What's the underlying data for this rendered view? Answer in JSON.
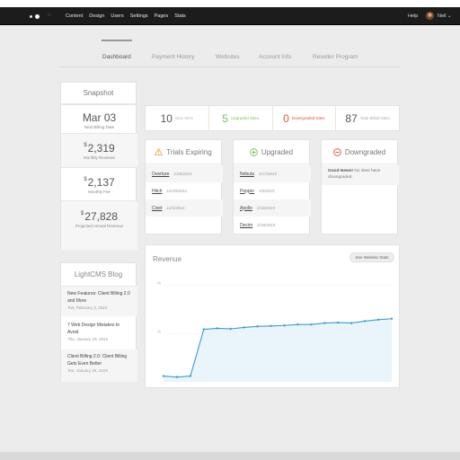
{
  "topbar": {
    "logo_mark": "™",
    "nav": [
      "Content",
      "Design",
      "Users",
      "Settings",
      "Pages",
      "Stats"
    ],
    "help": "Help",
    "user_name": "Neil ⌄"
  },
  "tabs": [
    "Dashboard",
    "Payment History",
    "Websites",
    "Account Info",
    "Reseller Program"
  ],
  "snapshot": {
    "title": "Snapshot",
    "items": [
      {
        "value": "Mar 03",
        "prefix": "",
        "label": "Next Billing Date"
      },
      {
        "value": "2,319",
        "prefix": "$",
        "label": "Monthly Revenue"
      },
      {
        "value": "2,137",
        "prefix": "$",
        "label": "Monthly Fee"
      },
      {
        "value": "27,828",
        "prefix": "$",
        "label": "Projected Annual Revenue"
      }
    ]
  },
  "blog": {
    "title": "LightCMS Blog",
    "posts": [
      {
        "title": "New Features: Client Billing 2.0 and More",
        "date": "Tue, February 3, 2015"
      },
      {
        "title": "7 Web Design Mistakes to Avoid",
        "date": "Thu, January 29, 2015"
      },
      {
        "title": "Client Billing 2.0: Client Billing Gets Even Better",
        "date": "Tue, January 20, 2015"
      }
    ]
  },
  "stats": [
    {
      "number": "10",
      "label": "New Sites"
    },
    {
      "number": "5",
      "label": "Upgraded Sites"
    },
    {
      "number": "0",
      "label": "Downgraded Sites"
    },
    {
      "number": "87",
      "label": "Total Billed Sites"
    }
  ],
  "trials": {
    "title": "Trials Expiring",
    "icon": "warning-icon",
    "rows": [
      {
        "name": "Overture",
        "date": "1/18/2015"
      },
      {
        "name": "Hitch",
        "date": "12/19/2014"
      },
      {
        "name": "Civet",
        "date": "12/1/2014"
      }
    ]
  },
  "upgraded": {
    "title": "Upgraded",
    "icon": "plus-circle-icon",
    "rows": [
      {
        "name": "Nebula",
        "date": "1/17/2015"
      },
      {
        "name": "Pepper",
        "date": "1/5/2015"
      },
      {
        "name": "Apollo",
        "date": "2/16/2015"
      },
      {
        "name": "Decim",
        "date": "2/16/2015"
      }
    ]
  },
  "downgraded": {
    "title": "Downgraded",
    "icon": "minus-circle-icon",
    "notice_strong": "Good News!",
    "notice_text": " No sites have downgraded."
  },
  "revenue": {
    "title": "Revenue",
    "button": "See Website Stats"
  },
  "colors": {
    "green": "#7fbf5f",
    "red": "#e0533d",
    "warning": "#f0ad4e",
    "line": "#3d9bd6"
  },
  "chart_data": {
    "type": "area",
    "title": "Revenue",
    "y_tick_labels": [
      "2k",
      "1k"
    ],
    "ylim": [
      0,
      2200
    ],
    "series": [
      {
        "values": [
          120,
          100,
          120,
          1090,
          1110,
          1100,
          1130,
          1150,
          1160,
          1170,
          1190,
          1190,
          1220,
          1230,
          1220,
          1260,
          1290,
          1310
        ]
      }
    ],
    "grid": true
  }
}
